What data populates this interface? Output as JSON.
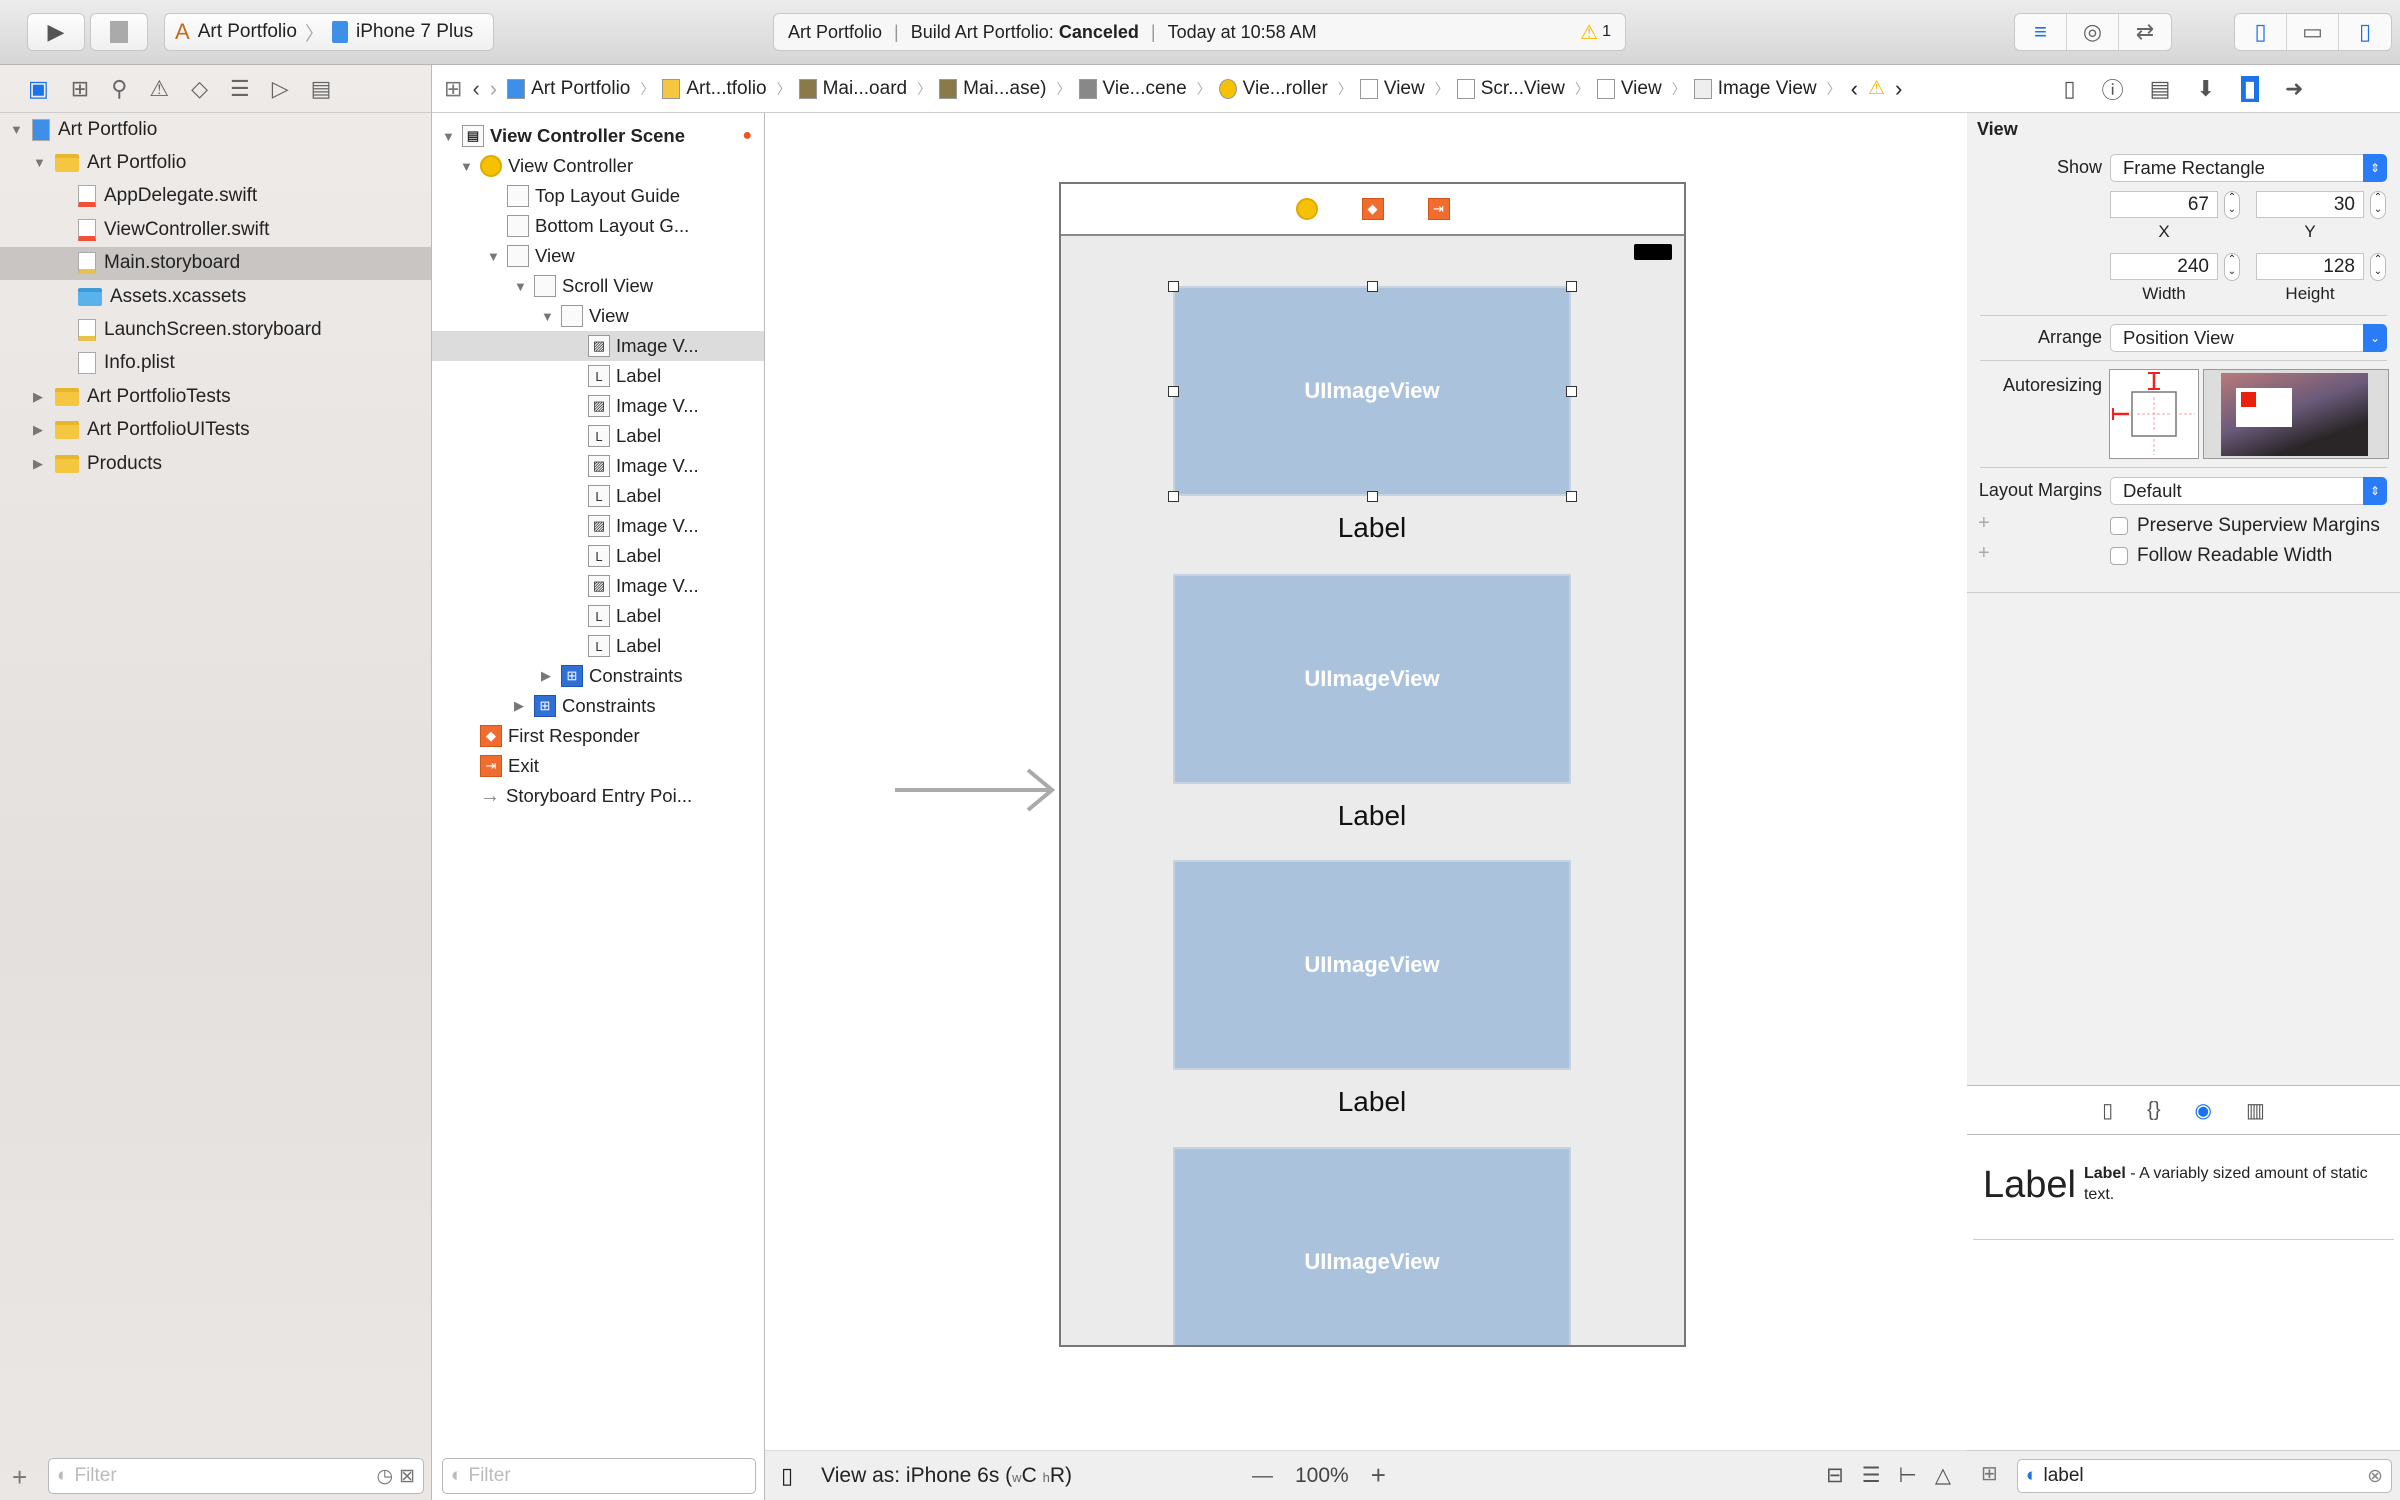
{
  "toolbar": {
    "scheme": "Art Portfolio",
    "device": "iPhone 7 Plus",
    "activity": {
      "project": "Art Portfolio",
      "build_prefix": "Build Art Portfolio:",
      "build_status": "Canceled",
      "time": "Today at 10:58 AM",
      "warnings": "1"
    }
  },
  "jumpbar": {
    "crumbs": [
      "Art Portfolio",
      "Art...tfolio",
      "Mai...oard",
      "Mai...ase)",
      "Vie...cene",
      "Vie...roller",
      "View",
      "Scr...View",
      "View",
      "Image View"
    ]
  },
  "navigator": {
    "items": [
      {
        "label": "Art Portfolio",
        "type": "project",
        "level": 0,
        "open": true
      },
      {
        "label": "Art Portfolio",
        "type": "folder",
        "level": 1,
        "open": true
      },
      {
        "label": "AppDelegate.swift",
        "type": "swift",
        "level": 2
      },
      {
        "label": "ViewController.swift",
        "type": "swift",
        "level": 2
      },
      {
        "label": "Main.storyboard",
        "type": "storyboard",
        "level": 2,
        "selected": true
      },
      {
        "label": "Assets.xcassets",
        "type": "assets",
        "level": 2
      },
      {
        "label": "LaunchScreen.storyboard",
        "type": "storyboard",
        "level": 2
      },
      {
        "label": "Info.plist",
        "type": "plist",
        "level": 2
      },
      {
        "label": "Art PortfolioTests",
        "type": "folder",
        "level": 1,
        "open": false
      },
      {
        "label": "Art PortfolioUITests",
        "type": "folder",
        "level": 1,
        "open": false
      },
      {
        "label": "Products",
        "type": "folder",
        "level": 1,
        "open": false
      }
    ],
    "filter_placeholder": "Filter"
  },
  "outline": {
    "scene": "View Controller Scene",
    "items": [
      {
        "label": "View Controller",
        "level": 1,
        "icon": "vc",
        "tri": "open"
      },
      {
        "label": "Top Layout Guide",
        "level": 2,
        "icon": "guide"
      },
      {
        "label": "Bottom Layout G...",
        "level": 2,
        "icon": "guide"
      },
      {
        "label": "View",
        "level": 2,
        "icon": "view",
        "tri": "open"
      },
      {
        "label": "Scroll View",
        "level": 3,
        "icon": "view",
        "tri": "open"
      },
      {
        "label": "View",
        "level": 4,
        "icon": "view",
        "tri": "open"
      },
      {
        "label": "Image V...",
        "level": 5,
        "icon": "image",
        "selected": true
      },
      {
        "label": "Label",
        "level": 5,
        "icon": "label"
      },
      {
        "label": "Image V...",
        "level": 5,
        "icon": "image"
      },
      {
        "label": "Label",
        "level": 5,
        "icon": "label"
      },
      {
        "label": "Image V...",
        "level": 5,
        "icon": "image"
      },
      {
        "label": "Label",
        "level": 5,
        "icon": "label"
      },
      {
        "label": "Image V...",
        "level": 5,
        "icon": "image"
      },
      {
        "label": "Label",
        "level": 5,
        "icon": "label"
      },
      {
        "label": "Image V...",
        "level": 5,
        "icon": "image"
      },
      {
        "label": "Label",
        "level": 5,
        "icon": "label"
      },
      {
        "label": "Label",
        "level": 5,
        "icon": "label"
      },
      {
        "label": "Constraints",
        "level": 4,
        "icon": "constraints",
        "tri": "closed"
      },
      {
        "label": "Constraints",
        "level": 3,
        "icon": "constraints",
        "tri": "closed"
      },
      {
        "label": "First Responder",
        "level": 1,
        "icon": "responder"
      },
      {
        "label": "Exit",
        "level": 1,
        "icon": "exit"
      },
      {
        "label": "Storyboard Entry Poi...",
        "level": 1,
        "icon": "arrow"
      }
    ],
    "filter_placeholder": "Filter"
  },
  "canvas": {
    "image_view_text": "UIImageView",
    "label_text": "Label",
    "view_as": "View as: iPhone 6s (",
    "size_w": "w",
    "size_c": "C",
    "size_h": "h",
    "size_r": "R)",
    "zoom": "100%"
  },
  "inspector": {
    "section": "View",
    "show_label": "Show",
    "show_value": "Frame Rectangle",
    "x": "67",
    "y": "30",
    "width": "240",
    "height": "128",
    "x_label": "X",
    "y_label": "Y",
    "width_label": "Width",
    "height_label": "Height",
    "arrange_label": "Arrange",
    "arrange_value": "Position View",
    "autoresizing_label": "Autoresizing",
    "layout_margins_label": "Layout Margins",
    "layout_margins_value": "Default",
    "preserve_label": "Preserve Superview Margins",
    "preserve_checked": false,
    "readable_label": "Follow Readable Width",
    "readable_checked": false
  },
  "library": {
    "item_preview": "Label",
    "item_name": "Label",
    "item_desc": " - A variably sized amount of static text.",
    "search_value": "label"
  },
  "colors": {
    "accent": "#1a73e8",
    "image_view": "#abc2dd",
    "warning": "#f5b800"
  }
}
